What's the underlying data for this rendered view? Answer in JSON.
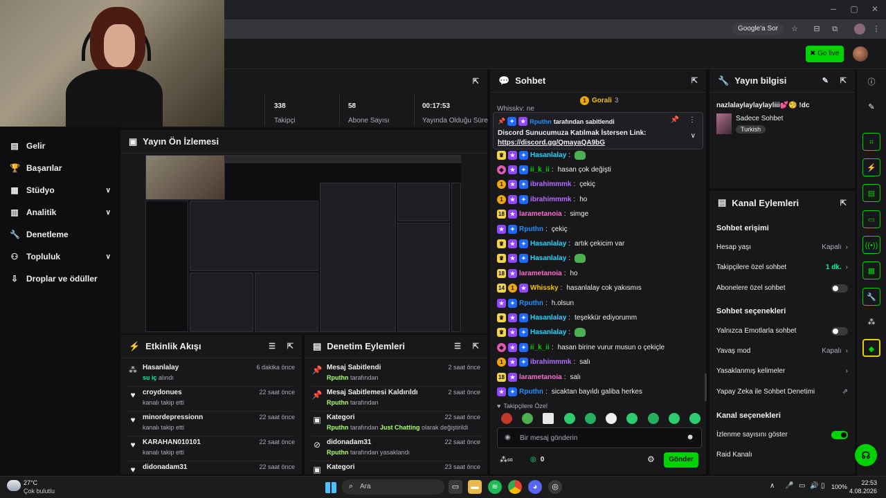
{
  "browser": {
    "google_chip": "Google'a Sor"
  },
  "topbar": {
    "golive_label": "Go live"
  },
  "sidebar": {
    "items": [
      {
        "label": "Gelir"
      },
      {
        "label": "Başarılar"
      },
      {
        "label": "Stüdyo"
      },
      {
        "label": "Analitik"
      },
      {
        "label": "Denetleme"
      },
      {
        "label": "Topluluk"
      },
      {
        "label": "Droplar ve ödüller"
      }
    ]
  },
  "stats": [
    {
      "value": "338",
      "label": "Takipçi"
    },
    {
      "value": "58",
      "label": "Abone Sayısı"
    },
    {
      "value": "00:17:53",
      "label": "Yayında Olduğu Süre"
    }
  ],
  "preview": {
    "title": "Yayın Ön İzlemesi"
  },
  "activity": {
    "title": "Etkinlik Akışı",
    "items": [
      {
        "name": "Hasanlalay",
        "detail_highlight": "su iç",
        "detail_rest": " alındı",
        "time": "6 dakika önce"
      },
      {
        "name": "croydonues",
        "detail_rest": "kanalı takip etti",
        "time": "22 saat önce"
      },
      {
        "name": "minordepressionn",
        "detail_rest": "kanalı takip etti",
        "time": "22 saat önce"
      },
      {
        "name": "KARAHAN010101",
        "detail_rest": "kanalı takip etti",
        "time": "22 saat önce"
      },
      {
        "name": "didonadam31",
        "detail_rest": "",
        "time": "22 saat önce"
      }
    ]
  },
  "moderation": {
    "title": "Denetim Eylemleri",
    "items": [
      {
        "title": "Mesaj Sabitlendi",
        "by": "Rputhn",
        "rest": " tarafından",
        "time": "2 saat önce"
      },
      {
        "title": "Mesaj Sabitlemesi Kaldırıldı",
        "by": "Rputhn",
        "rest": " tarafından",
        "time": "2 saat önce"
      },
      {
        "title": "Kategori",
        "by": "Rputhn",
        "rest": " tarafından ",
        "extra": "Just Chatting",
        "rest2": " olarak değiştirildi",
        "time": "22 saat önce"
      },
      {
        "title": "didonadam31",
        "by": "Rputhn",
        "rest": " tarafından yasaklandı",
        "time": "22 saat önce"
      },
      {
        "title": "Kategori",
        "by": "",
        "rest": "",
        "time": "23 saat önce"
      }
    ]
  },
  "chat": {
    "title": "Sohbet",
    "hype": "Gorali",
    "hype_count": "3",
    "partial_top": "Whisskv: ne",
    "pinned_by": "Rputhn",
    "pinned_by_suffix": " tarafından sabitlendi",
    "pinned_text": "Discord Sunucumuza Katılmak İstersen Link:",
    "pinned_link": "https://discord.gg/QmayaQA9bG",
    "messages": [
      {
        "user": "Hasanlalay",
        "color": "#1ed8ff",
        "text": "",
        "emote": true,
        "badges": [
          "yr",
          "sub",
          "blue"
        ]
      },
      {
        "user": "ii_k_ii",
        "color": "#00d400",
        "text": "hasan çok değişti",
        "badges": [
          "pink",
          "sub",
          "blue"
        ]
      },
      {
        "user": "ibrahimmmk",
        "color": "#b26eff",
        "text": "çekiç",
        "badges": [
          "lvl",
          "sub",
          "blue"
        ]
      },
      {
        "user": "ibrahimmmk",
        "color": "#b26eff",
        "text": "ho",
        "badges": [
          "lvl",
          "sub",
          "blue"
        ]
      },
      {
        "user": "larametanoia",
        "color": "#ff6ad5",
        "text": "simge",
        "badges": [
          "yr18",
          "sub"
        ]
      },
      {
        "user": "Rputhn",
        "color": "#1e90ff",
        "text": "çekiç",
        "badges": [
          "sub",
          "blue"
        ]
      },
      {
        "user": "Hasanlalay",
        "color": "#1ed8ff",
        "text": "artık çekicim var",
        "badges": [
          "yr",
          "sub",
          "blue"
        ]
      },
      {
        "user": "Hasanlalay",
        "color": "#1ed8ff",
        "text": "",
        "emote": true,
        "badges": [
          "yr",
          "sub",
          "blue"
        ]
      },
      {
        "user": "larametanoia",
        "color": "#ff6ad5",
        "text": "ho",
        "badges": [
          "yr18",
          "sub"
        ]
      },
      {
        "user": "Whissky",
        "color": "#f5c400",
        "text": "hasanlalay cok yakısmıs",
        "badges": [
          "yr14",
          "lvl",
          "sub"
        ]
      },
      {
        "user": "Rputhn",
        "color": "#1e90ff",
        "text": "h.olsun",
        "badges": [
          "sub",
          "blue"
        ]
      },
      {
        "user": "Hasanlalay",
        "color": "#1ed8ff",
        "text": "teşekkür ediyorumm",
        "badges": [
          "yr",
          "sub",
          "blue"
        ]
      },
      {
        "user": "Hasanlalay",
        "color": "#1ed8ff",
        "text": "",
        "emote": true,
        "badges": [
          "yr",
          "sub",
          "blue"
        ]
      },
      {
        "user": "ii_k_ii",
        "color": "#00d400",
        "text": "hasan birine vurur musun o çekiçle",
        "badges": [
          "pink",
          "sub",
          "blue"
        ]
      },
      {
        "user": "ibrahimmmk",
        "color": "#b26eff",
        "text": "salı",
        "badges": [
          "lvl",
          "sub",
          "blue"
        ]
      },
      {
        "user": "larametanoia",
        "color": "#ff6ad5",
        "text": "salı",
        "badges": [
          "yr18",
          "sub"
        ]
      },
      {
        "user": "Rputhn",
        "color": "#1e90ff",
        "text": "sicaktan bayıldı galiba herkes",
        "badges": [
          "sub",
          "blue"
        ]
      }
    ],
    "followers_only": "Takipçilere Özel",
    "input_placeholder": "Bir mesaj gönderin",
    "points": "0",
    "send_label": "Gönder"
  },
  "streaminfo": {
    "title": "Yayın bilgisi",
    "stream_title": "nazlalaylaylaylayliii💕🧐 !dc",
    "category": "Sadece Sohbet",
    "tag": "Turkish"
  },
  "channel": {
    "title": "Kanal Eylemleri",
    "sec1": "Sohbet erişimi",
    "rows1": [
      {
        "label": "Hesap yaşı",
        "value": "Kapalı"
      },
      {
        "label": "Takipçilere özel sohbet",
        "value": "1 dk."
      },
      {
        "label": "Abonelere özel sohbet"
      }
    ],
    "sec2": "Sohbet seçenekleri",
    "rows2": [
      {
        "label": "Yalnızca Emotlarla sohbet"
      },
      {
        "label": "Yavaş mod",
        "value": "Kapalı"
      },
      {
        "label": "Yasaklanmış kelimeler"
      },
      {
        "label": "Yapay Zeka ile Sohbet Denetimi"
      }
    ],
    "sec3": "Kanal seçenekleri",
    "rows3": [
      {
        "label": "İzlenme sayısını göster"
      },
      {
        "label": "Raid Kanalı"
      }
    ]
  },
  "taskbar": {
    "weather_temp": "27°C",
    "weather_desc": "Çok bulutlu",
    "search": "Ara",
    "battery": "100%",
    "time": "22:53",
    "date": "4.08.2026"
  },
  "colors": {
    "accent": "#00d400",
    "panel": "#18181b",
    "bg": "#0e0e10"
  }
}
